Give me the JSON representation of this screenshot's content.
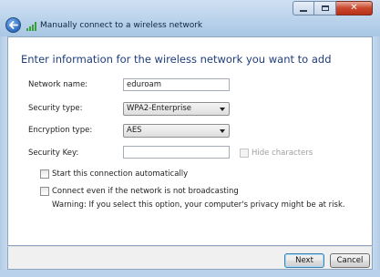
{
  "window": {
    "title": "Manually connect to a wireless network"
  },
  "main": {
    "heading": "Enter information for the wireless network you want to add"
  },
  "form": {
    "network_name_label": "Network name:",
    "network_name_value": "eduroam",
    "security_type_label": "Security type:",
    "security_type_value": "WPA2-Enterprise",
    "encryption_type_label": "Encryption type:",
    "encryption_type_value": "AES",
    "security_key_label": "Security Key:",
    "security_key_value": "",
    "hide_characters_label": "Hide characters",
    "start_auto_label": "Start this connection automatically",
    "connect_even_label": "Connect even if the network is not broadcasting",
    "warning_text": "Warning: If you select this option, your computer's privacy might be at risk."
  },
  "footer": {
    "next_label": "Next",
    "cancel_label": "Cancel"
  },
  "colors": {
    "heading": "#1f3d7a",
    "titlebar": "#b9d1ea",
    "close_button": "#c9462c"
  },
  "icons": {
    "back": "back-arrow-icon",
    "network": "wireless-signal-icon",
    "minimize": "minimize-icon",
    "maximize": "maximize-icon",
    "close": "close-icon"
  }
}
